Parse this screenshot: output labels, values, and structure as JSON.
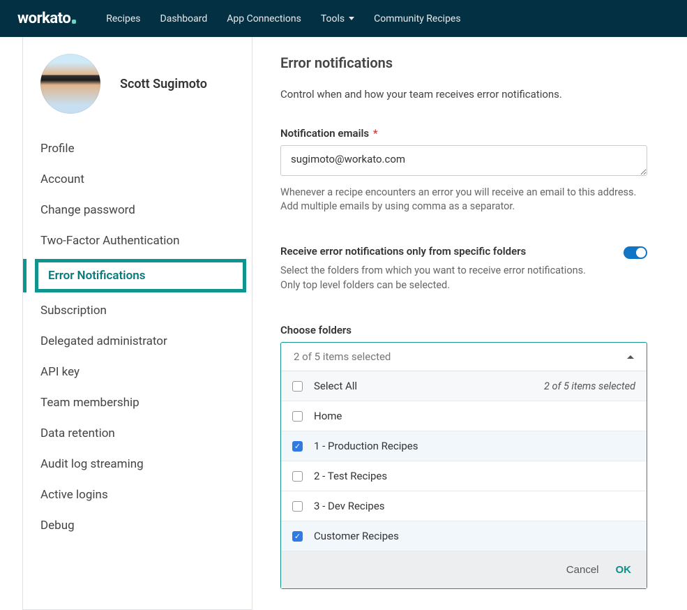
{
  "brand": "workato",
  "nav": {
    "items": [
      "Recipes",
      "Dashboard",
      "App Connections",
      "Tools",
      "Community Recipes"
    ]
  },
  "user": {
    "name": "Scott Sugimoto"
  },
  "sidebar": {
    "items": [
      "Profile",
      "Account",
      "Change password",
      "Two-Factor Authentication",
      "Error Notifications",
      "Subscription",
      "Delegated administrator",
      "API key",
      "Team membership",
      "Data retention",
      "Audit log streaming",
      "Active logins",
      "Debug"
    ],
    "active_index": 4
  },
  "main": {
    "title": "Error notifications",
    "description": "Control when and how your team receives error notifications.",
    "email_field": {
      "label": "Notification emails",
      "required": "*",
      "value": "sugimoto@workato.com",
      "help": "Whenever a recipe encounters an error you will receive an email to this address. Add multiple emails by using comma as a separator."
    },
    "toggle": {
      "title": "Receive error notifications only from specific folders",
      "desc": "Select the folders from which you want to receive error notifications. Only top level folders can be selected.",
      "on": true
    },
    "folders": {
      "label": "Choose folders",
      "summary": "2 of 5 items selected",
      "select_all_label": "Select All",
      "select_all_status": "2 of 5 items selected",
      "options": [
        {
          "label": "Home",
          "checked": false
        },
        {
          "label": "1 - Production Recipes",
          "checked": true
        },
        {
          "label": "2 - Test Recipes",
          "checked": false
        },
        {
          "label": "3 - Dev Recipes",
          "checked": false
        },
        {
          "label": "Customer Recipes",
          "checked": true
        }
      ],
      "cancel": "Cancel",
      "ok": "OK"
    }
  }
}
